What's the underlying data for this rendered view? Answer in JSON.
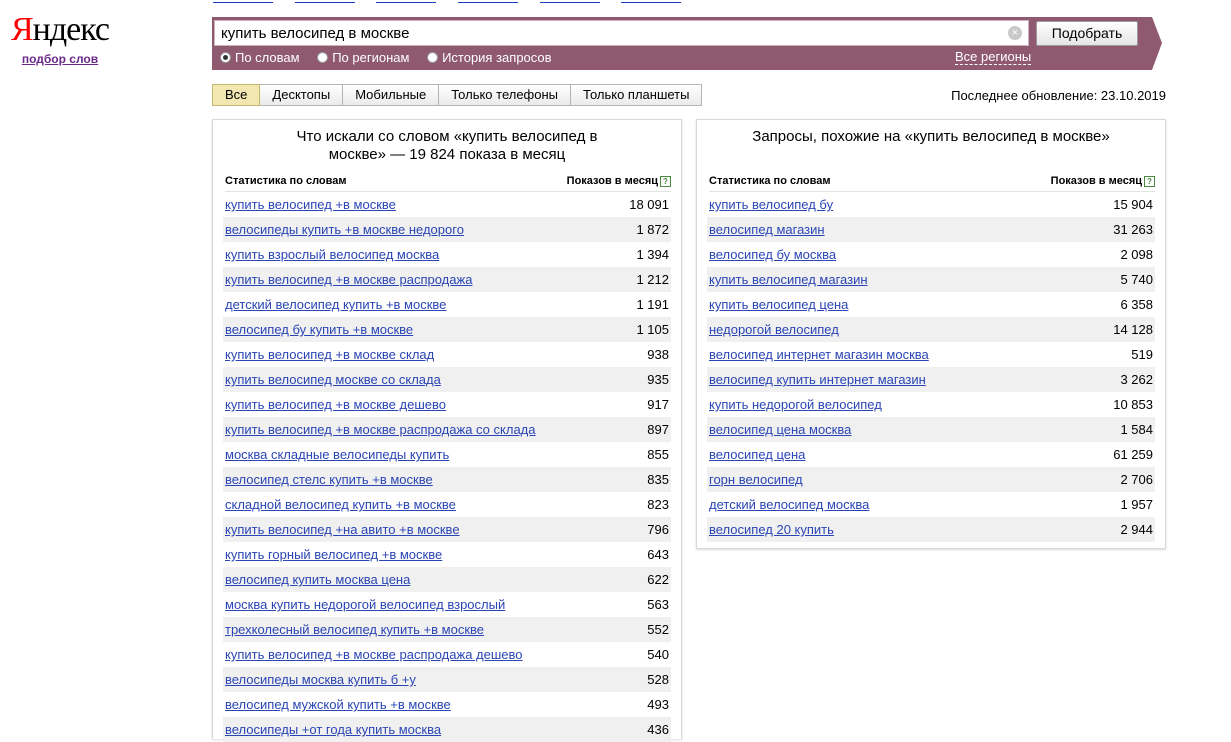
{
  "logo": {
    "text_first": "Я",
    "text_rest": "ндекс",
    "subtitle": "подбор слов"
  },
  "search": {
    "query": "купить велосипед в москве",
    "submit_label": "Подобрать",
    "clear_icon": "close-icon",
    "modes": [
      {
        "label": "По словам",
        "checked": true
      },
      {
        "label": "По регионам",
        "checked": false
      },
      {
        "label": "История запросов",
        "checked": false
      }
    ],
    "regions_label": "Все регионы",
    "bar_color": "#8f5a70"
  },
  "tabs": [
    {
      "label": "Все",
      "active": true
    },
    {
      "label": "Десктопы",
      "active": false
    },
    {
      "label": "Мобильные",
      "active": false
    },
    {
      "label": "Только телефоны",
      "active": false
    },
    {
      "label": "Только планшеты",
      "active": false
    }
  ],
  "last_update": "Последнее обновление: 23.10.2019",
  "left_panel": {
    "title_line1": "Что искали со словом «купить велосипед в",
    "title_line2": "москве» — 19 824 показа в месяц",
    "col_phrase": "Статистика по словам",
    "col_count": "Показов в месяц",
    "rows": [
      {
        "phrase": "купить велосипед +в москве",
        "count": "18 091"
      },
      {
        "phrase": "велосипеды купить +в москве недорого",
        "count": "1 872"
      },
      {
        "phrase": "купить взрослый велосипед москва",
        "count": "1 394"
      },
      {
        "phrase": "купить велосипед +в москве распродажа",
        "count": "1 212"
      },
      {
        "phrase": "детский велосипед купить +в москве",
        "count": "1 191"
      },
      {
        "phrase": "велосипед бу купить +в москве",
        "count": "1 105"
      },
      {
        "phrase": "купить велосипед +в москве склад",
        "count": "938"
      },
      {
        "phrase": "купить велосипед москве со склада",
        "count": "935"
      },
      {
        "phrase": "купить велосипед +в москве дешево",
        "count": "917"
      },
      {
        "phrase": "купить велосипед +в москве распродажа со склада",
        "count": "897"
      },
      {
        "phrase": "москва складные велосипеды купить",
        "count": "855"
      },
      {
        "phrase": "велосипед стелс купить +в москве",
        "count": "835"
      },
      {
        "phrase": "складной велосипед купить +в москве",
        "count": "823"
      },
      {
        "phrase": "купить велосипед +на авито +в москве",
        "count": "796"
      },
      {
        "phrase": "купить горный велосипед +в москве",
        "count": "643"
      },
      {
        "phrase": "велосипед купить москва цена",
        "count": "622"
      },
      {
        "phrase": "москва купить недорогой велосипед взрослый",
        "count": "563"
      },
      {
        "phrase": "трехколесный велосипед купить +в москве",
        "count": "552"
      },
      {
        "phrase": "купить велосипед +в москве распродажа дешево",
        "count": "540"
      },
      {
        "phrase": "велосипеды москва купить б +у",
        "count": "528"
      },
      {
        "phrase": "велосипед мужской купить +в москве",
        "count": "493"
      },
      {
        "phrase": "велосипеды +от года купить москва",
        "count": "436"
      }
    ]
  },
  "right_panel": {
    "title_line1": "Запросы, похожие на «купить велосипед в москве»",
    "title_line2": "",
    "col_phrase": "Статистика по словам",
    "col_count": "Показов в месяц",
    "rows": [
      {
        "phrase": "купить велосипед бу",
        "count": "15 904"
      },
      {
        "phrase": "велосипед магазин",
        "count": "31 263"
      },
      {
        "phrase": "велосипед бу москва",
        "count": "2 098"
      },
      {
        "phrase": "купить велосипед магазин",
        "count": "5 740"
      },
      {
        "phrase": "купить велосипед цена",
        "count": "6 358"
      },
      {
        "phrase": "недорогой велосипед",
        "count": "14 128"
      },
      {
        "phrase": "велосипед интернет магазин москва",
        "count": "519"
      },
      {
        "phrase": "велосипед купить интернет магазин",
        "count": "3 262"
      },
      {
        "phrase": "купить недорогой велосипед",
        "count": "10 853"
      },
      {
        "phrase": "велосипед цена москва",
        "count": "1 584"
      },
      {
        "phrase": "велосипед цена",
        "count": "61 259"
      },
      {
        "phrase": "горн велосипед",
        "count": "2 706"
      },
      {
        "phrase": "детский велосипед москва",
        "count": "1 957"
      },
      {
        "phrase": "велосипед 20 купить",
        "count": "2 944"
      }
    ]
  }
}
